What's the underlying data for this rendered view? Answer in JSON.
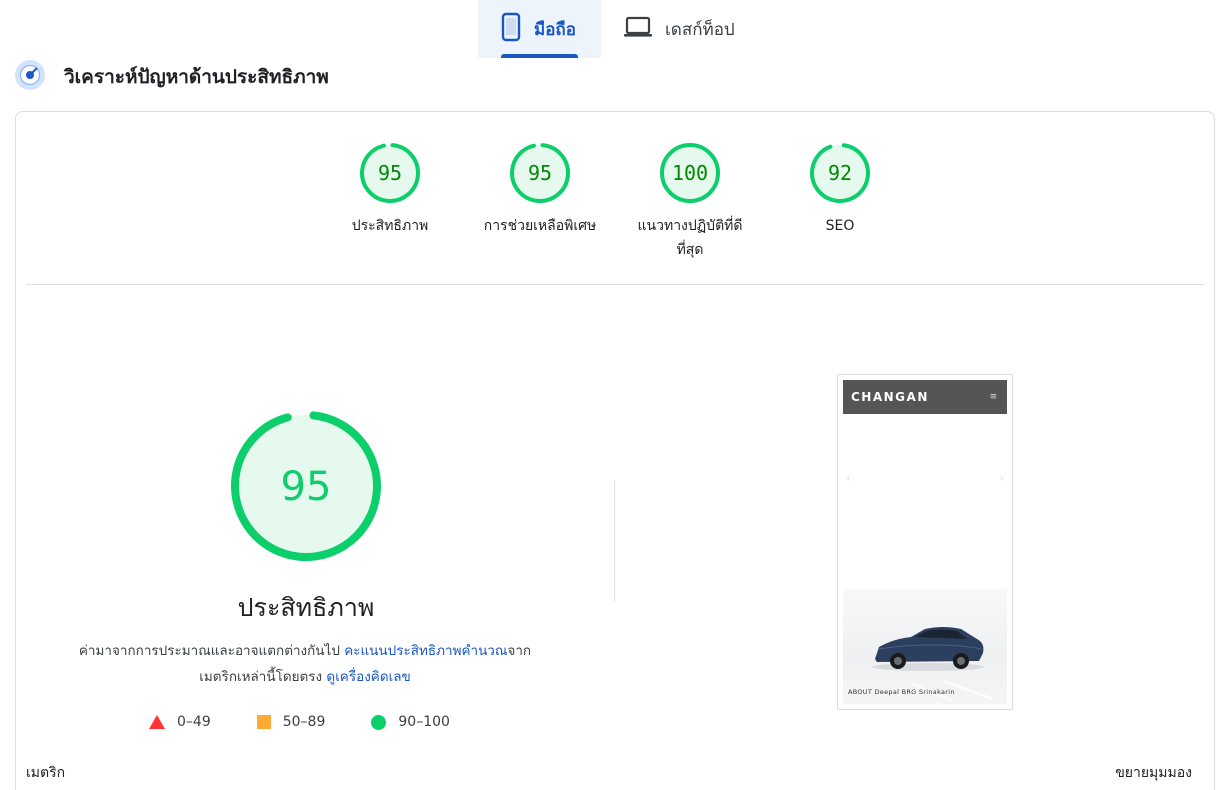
{
  "tabs": [
    {
      "label": "มือถือ",
      "icon": "smartphone-icon",
      "active": true
    },
    {
      "label": "เดสก์ท็อป",
      "icon": "laptop-icon",
      "active": false
    }
  ],
  "header": {
    "title": "วิเคราะห์ปัญหาด้านประสิทธิภาพ",
    "icon": "radar-icon"
  },
  "gauges": [
    {
      "score": "95",
      "label_line1": "ประสิทธิภาพ",
      "label_line2": ""
    },
    {
      "score": "95",
      "label_line1": "การช่วยเหลือพิเศษ",
      "label_line2": ""
    },
    {
      "score": "100",
      "label_line1": "แนวทางปฏิบัติที่ดี",
      "label_line2": "ที่สุด"
    },
    {
      "score": "92",
      "label_line1": "SEO",
      "label_line2": ""
    }
  ],
  "main": {
    "score": "95",
    "title": "ประสิทธิภาพ",
    "desc_part1": "ค่ามาจากการประมาณและอาจแตกต่างกันไป",
    "desc_link1": "คะแนนประสิทธิภาพคำนวณ",
    "desc_part2": "จากเมตริกเหล่านี้โดยตรง",
    "desc_link2": "ดูเครื่องคิดเลข"
  },
  "legend": [
    {
      "label": "0–49",
      "shape": "triangle",
      "color": "#ff3333"
    },
    {
      "label": "50–89",
      "shape": "square",
      "color": "#ffaa33"
    },
    {
      "label": "90–100",
      "shape": "circle",
      "color": "#0cce6b"
    }
  ],
  "screenshot": {
    "brand": "CHANGAN",
    "menu": "≡",
    "caption": "ABOUT Deepal BRG Srinakarin"
  },
  "footer": {
    "left": "เมตริก",
    "right": "ขยายมุมมอง"
  },
  "colors": {
    "accent": "#1a57c4",
    "pass": "#0cce6b",
    "pass_text": "#008800",
    "pass_bg": "#e6f9ee"
  }
}
